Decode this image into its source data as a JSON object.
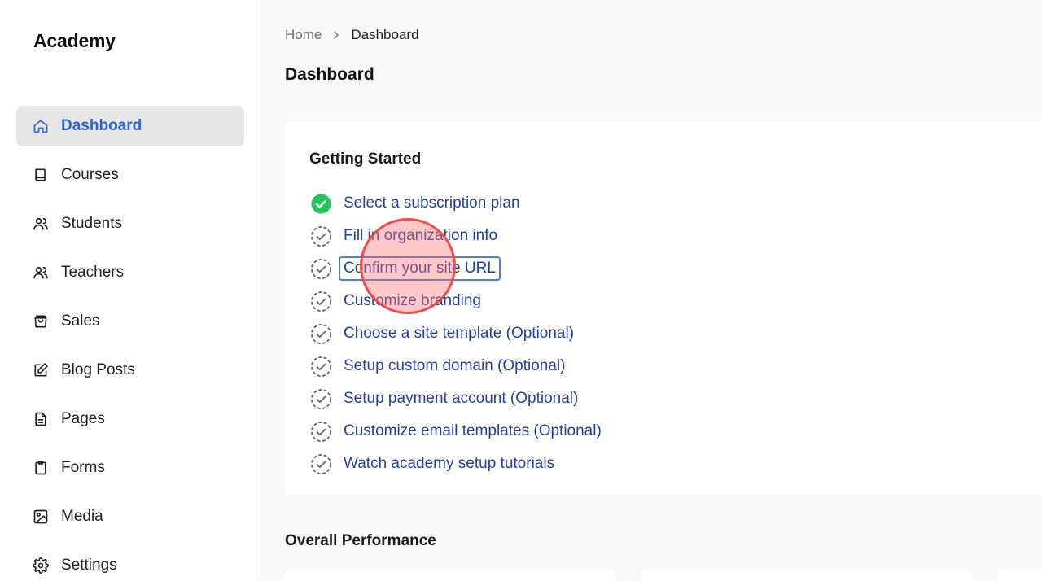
{
  "app": {
    "brand": "Academy"
  },
  "sidebar": {
    "items": [
      {
        "label": "Dashboard",
        "icon": "home-icon",
        "active": true
      },
      {
        "label": "Courses",
        "icon": "book-icon"
      },
      {
        "label": "Students",
        "icon": "users-icon"
      },
      {
        "label": "Teachers",
        "icon": "users-icon"
      },
      {
        "label": "Sales",
        "icon": "shopping-bag-icon"
      },
      {
        "label": "Blog Posts",
        "icon": "edit-icon"
      },
      {
        "label": "Pages",
        "icon": "document-icon"
      },
      {
        "label": "Forms",
        "icon": "clipboard-icon"
      },
      {
        "label": "Media",
        "icon": "image-icon"
      },
      {
        "label": "Settings",
        "icon": "gear-icon"
      }
    ]
  },
  "breadcrumb": {
    "home": "Home",
    "current": "Dashboard"
  },
  "page": {
    "title": "Dashboard"
  },
  "getting_started": {
    "title": "Getting Started",
    "steps": [
      {
        "label": "Select a subscription plan",
        "done": true
      },
      {
        "label": "Fill in organization info",
        "done": false
      },
      {
        "label": "Confirm your site URL",
        "done": false,
        "focused": true
      },
      {
        "label": "Customize branding",
        "done": false
      },
      {
        "label": "Choose a site template (Optional)",
        "done": false
      },
      {
        "label": "Setup custom domain (Optional)",
        "done": false
      },
      {
        "label": "Setup payment account (Optional)",
        "done": false
      },
      {
        "label": "Customize email templates (Optional)",
        "done": false
      },
      {
        "label": "Watch academy setup tutorials",
        "done": false
      }
    ]
  },
  "performance": {
    "title": "Overall Performance"
  },
  "colors": {
    "accent": "#2b63d9",
    "link": "#2440a0",
    "success": "#22c55e",
    "focus_ring": "#4a7fd6",
    "click_marker": "#f04c4c"
  }
}
